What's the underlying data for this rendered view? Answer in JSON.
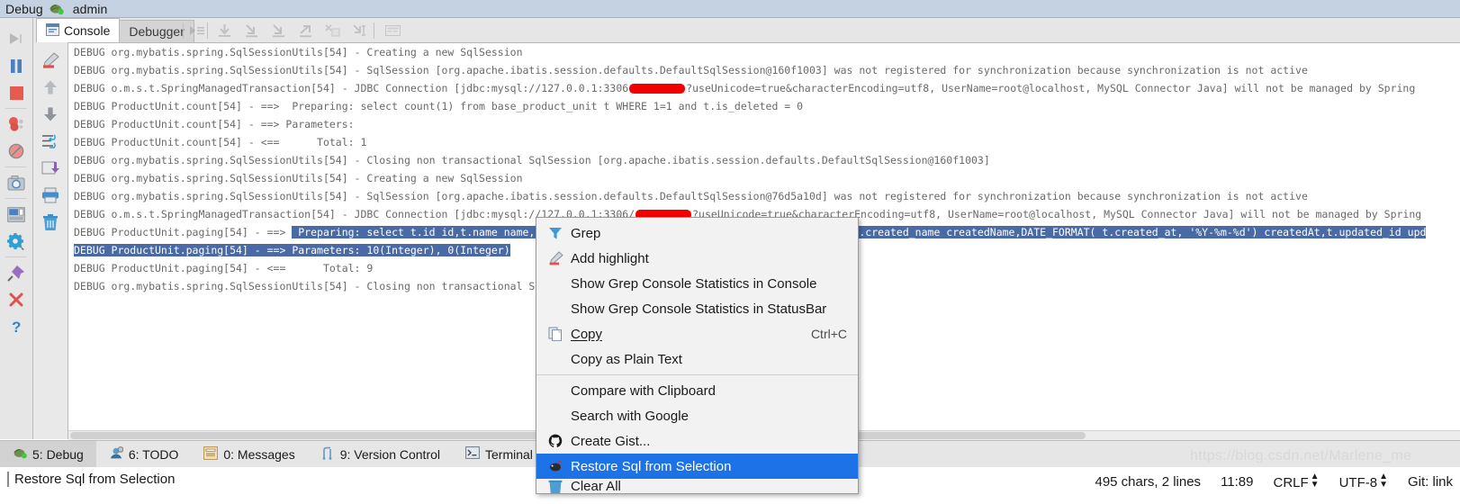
{
  "window": {
    "title": "Debug",
    "session": "admin",
    "bug_icon": "debug-bug-icon"
  },
  "toolbar": {
    "rerun_icon": "rerun-icon",
    "tabs": [
      {
        "label": "Console",
        "icon": "console-icon",
        "active": true
      },
      {
        "label": "Debugger",
        "icon": "",
        "active": false
      }
    ],
    "step_icons": [
      "show-execution-point-icon",
      "step-over-icon",
      "step-into-icon",
      "force-step-into-icon",
      "step-out-icon",
      "drop-frame-icon",
      "run-to-cursor-icon",
      "evaluate-expression-icon"
    ]
  },
  "rail_primary": [
    "rerun-icon",
    "resume-program-icon",
    "pause-program-icon",
    "stop-icon",
    "view-breakpoints-icon",
    "mute-breakpoints-icon",
    "settings-camera-icon",
    "layout-icon",
    "settings-gear-icon",
    "pin-tab-icon",
    "close-icon",
    "help-icon"
  ],
  "rail_secondary": [
    "add-highlight-icon",
    "scroll-up-icon",
    "scroll-down-icon",
    "soft-wrap-icon",
    "scroll-to-end-icon",
    "print-icon",
    "clear-all-icon"
  ],
  "console": {
    "lines": [
      {
        "text": "DEBUG org.mybatis.spring.SqlSessionUtils[54] - Creating a new SqlSession"
      },
      {
        "text": "DEBUG org.mybatis.spring.SqlSessionUtils[54] - SqlSession [org.apache.ibatis.session.defaults.DefaultSqlSession@160f1003] was not registered for synchronization because synchronization is not active"
      },
      {
        "pre": "DEBUG o.m.s.t.SpringManagedTransaction[54] - JDBC Connection [jdbc:mysql://127.0.0.1:3306",
        "redact": true,
        "post": "?useUnicode=true&characterEncoding=utf8, UserName=root@localhost, MySQL Connector Java] will not be managed by Spring"
      },
      {
        "text": "DEBUG ProductUnit.count[54] - ==>  Preparing: select count(1) from base_product_unit t WHERE 1=1 and t.is_deleted = 0"
      },
      {
        "text": "DEBUG ProductUnit.count[54] - ==> Parameters:"
      },
      {
        "text": "DEBUG ProductUnit.count[54] - <==      Total: 1"
      },
      {
        "text": "DEBUG org.mybatis.spring.SqlSessionUtils[54] - Closing non transactional SqlSession [org.apache.ibatis.session.defaults.DefaultSqlSession@160f1003]"
      },
      {
        "text": "DEBUG org.mybatis.spring.SqlSessionUtils[54] - Creating a new SqlSession"
      },
      {
        "text": "DEBUG org.mybatis.spring.SqlSessionUtils[54] - SqlSession [org.apache.ibatis.session.defaults.DefaultSqlSession@76d5a10d] was not registered for synchronization because synchronization is not active"
      },
      {
        "pre": "DEBUG o.m.s.t.SpringManagedTransaction[54] - JDBC Connection [jdbc:mysql://127.0.0.1:3306/",
        "redact": true,
        "post": "?useUnicode=true&characterEncoding=utf8, UserName=root@localhost, MySQL Connector Java] will not be managed by Spring"
      },
      {
        "prefix": "DEBUG ProductUnit.paging[54] - ==> ",
        "selected": " Preparing: select t.id id,t.name name,t.sequence_num sequence_num,t.created_id createdId,t.created_name createdName,DATE_FORMAT( t.created_at, '%Y-%m-%d') createdAt,t.updated_id upd"
      },
      {
        "prefix": "",
        "selected": "DEBUG ProductUnit.paging[54] - ==> Parameters: 10(Integer), 0(Integer)"
      },
      {
        "text": "DEBUG ProductUnit.paging[54] - <==      Total: 9"
      },
      {
        "text": "DEBUG org.mybatis.spring.SqlSessionUtils[54] - Closing non transactional SqlSession [org."
      }
    ]
  },
  "context_menu": {
    "items": [
      {
        "label": "Grep",
        "icon": "grep-filter-icon",
        "accel": "",
        "selected": false,
        "mnemonic": ""
      },
      {
        "label": "Add highlight",
        "icon": "add-highlight-icon",
        "accel": "",
        "selected": false
      },
      {
        "label": "Show Grep Console Statistics in Console",
        "icon": "",
        "accel": "",
        "selected": false
      },
      {
        "label": "Show Grep Console Statistics in StatusBar",
        "icon": "",
        "accel": "",
        "selected": false
      },
      {
        "label": "Copy",
        "icon": "copy-icon",
        "accel": "Ctrl+C",
        "selected": false
      },
      {
        "label": "Copy as Plain Text",
        "icon": "",
        "accel": "",
        "selected": false
      },
      {
        "separator": true
      },
      {
        "label": "Compare with Clipboard",
        "icon": "",
        "accel": "",
        "selected": false
      },
      {
        "label": "Search with Google",
        "icon": "",
        "accel": "",
        "selected": false
      },
      {
        "label": "Create Gist...",
        "icon": "github-icon",
        "accel": "",
        "selected": false
      },
      {
        "label": "Restore Sql from Selection",
        "icon": "restore-sql-icon",
        "accel": "",
        "selected": true
      },
      {
        "label": "Clear All",
        "icon": "clear-all-icon",
        "accel": "",
        "selected": false,
        "clipped": true
      }
    ]
  },
  "bottom_tabs": [
    {
      "label": "5: Debug",
      "icon": "debug-bug-icon",
      "active": true
    },
    {
      "label": "6: TODO",
      "icon": "todo-icon",
      "active": false
    },
    {
      "label": "0: Messages",
      "icon": "messages-icon",
      "active": false
    },
    {
      "label": "9: Version Control",
      "icon": "version-control-icon",
      "active": false
    },
    {
      "label": "Terminal",
      "icon": "terminal-icon",
      "active": false
    }
  ],
  "statusbar": {
    "message": "Restore Sql from Selection",
    "chars": "495 chars, 2 lines",
    "caret": "11:89",
    "line_separator": "CRLF",
    "encoding": "UTF-8",
    "git": "Git: link"
  },
  "watermark": "https://blog.csdn.net/Marlene_me",
  "colors": {
    "titlebar": "#c5d2e2",
    "selection": "#4a6aa5",
    "menu_selection": "#1d72e8",
    "redaction": "#f50000",
    "toolbar": "#e6e6e6"
  }
}
